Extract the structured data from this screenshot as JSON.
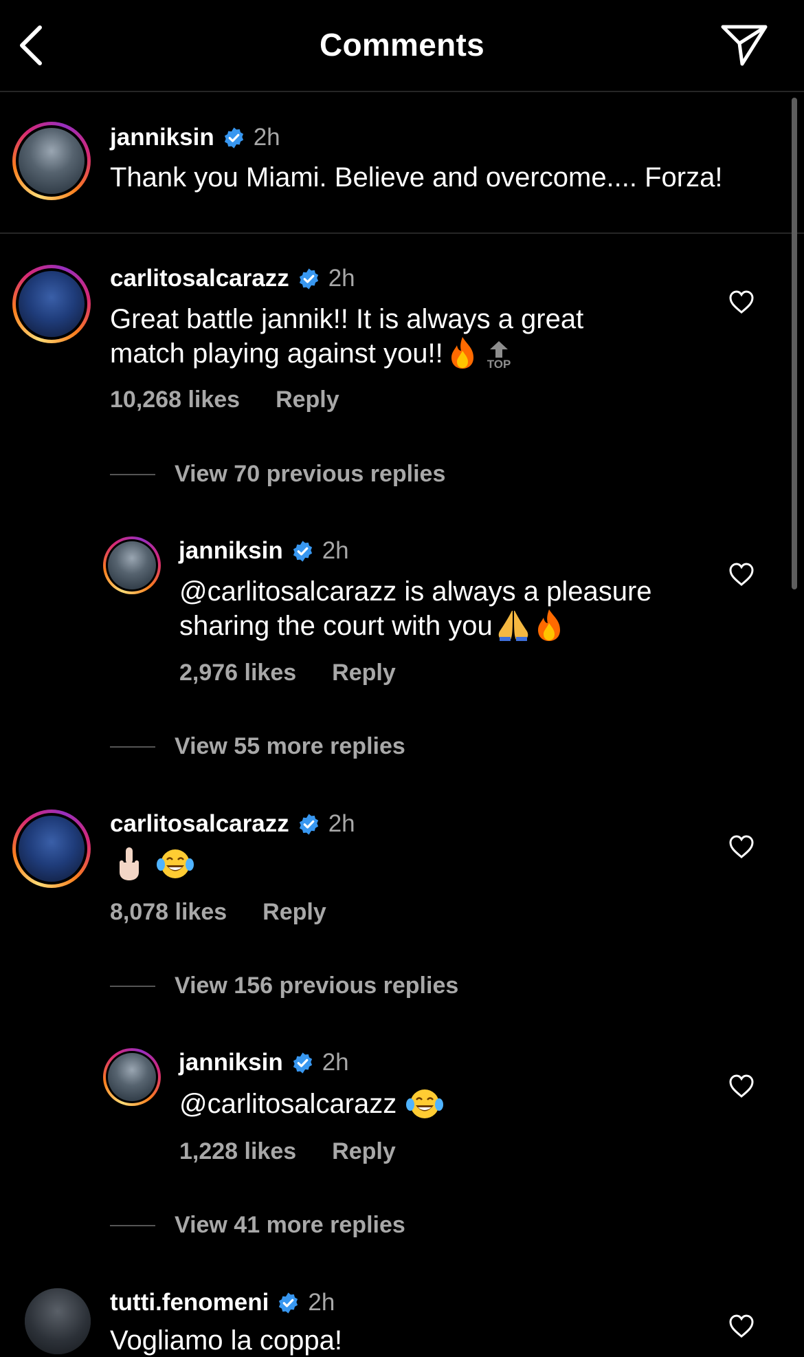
{
  "header": {
    "title": "Comments",
    "back_icon": "chevron-left-icon",
    "share_icon": "paper-plane-icon"
  },
  "caption": {
    "username": "janniksin",
    "time": "2h",
    "text": "Thank you Miami. Believe and overcome.... Forza!"
  },
  "comments": [
    {
      "username": "carlitosalcarazz",
      "time": "2h",
      "text_line1": "Great battle jannik!! It is always a great",
      "text_line2": "match playing against you!!",
      "top_label": "TOP",
      "likes": "10,268 likes",
      "reply": "Reply"
    },
    {
      "view_label": "View 70 previous replies"
    },
    {
      "username": "janniksin",
      "time": "2h",
      "text_line1": "@carlitosalcarazz is always a pleasure",
      "text_line2": "sharing the court with you",
      "likes": "2,976 likes",
      "reply": "Reply"
    },
    {
      "view_label": "View 55 more replies"
    },
    {
      "username": "carlitosalcarazz",
      "time": "2h",
      "likes": "8,078 likes",
      "reply": "Reply"
    },
    {
      "view_label": "View 156 previous replies"
    },
    {
      "username": "janniksin",
      "time": "2h",
      "text": "@carlitosalcarazz",
      "likes": "1,228 likes",
      "reply": "Reply"
    },
    {
      "view_label": "View 41 more replies"
    },
    {
      "username": "tutti.fenomeni",
      "time": "2h",
      "text": "Vogliamo la coppa!"
    }
  ],
  "colors": {
    "background": "#000000",
    "text": "#ffffff",
    "secondary": "#a8a8a8",
    "verified": "#3897f0"
  }
}
